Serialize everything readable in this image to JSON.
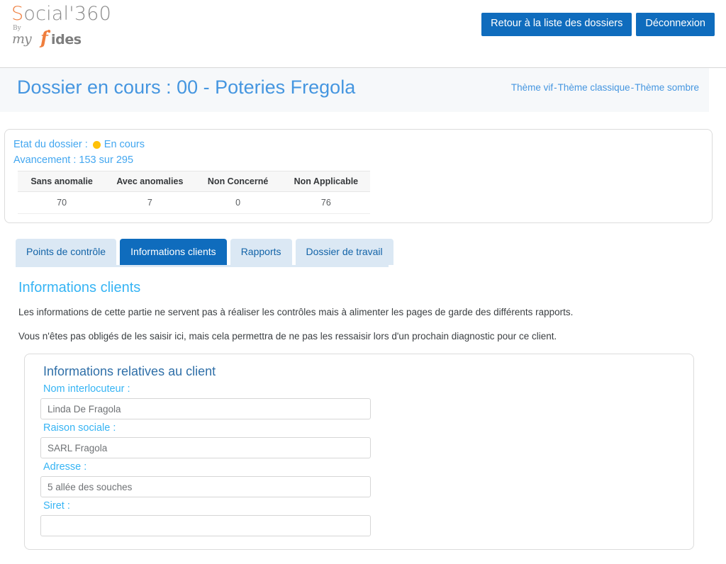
{
  "brand": {
    "name_main": "Social'360",
    "name_main_accent": "S",
    "name_main_rest": "ocial'360",
    "by": "By",
    "my": "my",
    "f": "f",
    "ides": "ides",
    "accent_color": "#ef7e3d",
    "gray_color": "#8a8a8a"
  },
  "header": {
    "back_button": "Retour à la liste des dossiers",
    "logout_button": "Déconnexion",
    "primary_color": "#0f6cbd"
  },
  "titlebar": {
    "title": "Dossier en cours : 00 - Poteries Fregola",
    "themes": [
      {
        "label": "Thème vif"
      },
      {
        "label": "Thème classique"
      },
      {
        "label": "Thème sombre"
      }
    ],
    "theme_separator": "-",
    "link_color": "#4596e0",
    "background": "#f6f8fa"
  },
  "status": {
    "state_label": "Etat du dossier :",
    "state_value": "En cours",
    "state_dot_color": "#ffc107",
    "progress_label": "Avancement :",
    "progress_value": "153 sur 295",
    "progress_text": "Avancement : 153 sur 295",
    "table": {
      "headers": [
        "Sans anomalie",
        "Avec anomalies",
        "Non Concerné",
        "Non Applicable"
      ],
      "rows": [
        [
          "70",
          "7",
          "0",
          "76"
        ]
      ]
    }
  },
  "tabs": [
    {
      "label": "Points de contrôle",
      "active": false
    },
    {
      "label": "Informations clients",
      "active": true
    },
    {
      "label": "Rapports",
      "active": false
    },
    {
      "label": "Dossier de travail",
      "active": false
    }
  ],
  "main": {
    "section_title": "Informations clients",
    "paragraph_1": "Les informations de cette partie ne servent pas à réaliser les contrôles mais à alimenter les pages de garde des différents rapports.",
    "paragraph_2": "Vous n'êtes pas obligés de les saisir ici, mais cela permettra de ne pas les ressaisir lors d'un prochain diagnostic pour ce client."
  },
  "form": {
    "card_title": "Informations relatives au client",
    "fields": [
      {
        "label": "Nom interlocuteur :",
        "value": "Linda De Fragola",
        "placeholder": ""
      },
      {
        "label": "Raison sociale :",
        "value": "SARL Fragola",
        "placeholder": ""
      },
      {
        "label": "Adresse :",
        "value": "5 allée des souches",
        "placeholder": ""
      },
      {
        "label": "Siret :",
        "value": "",
        "placeholder": ""
      }
    ]
  }
}
